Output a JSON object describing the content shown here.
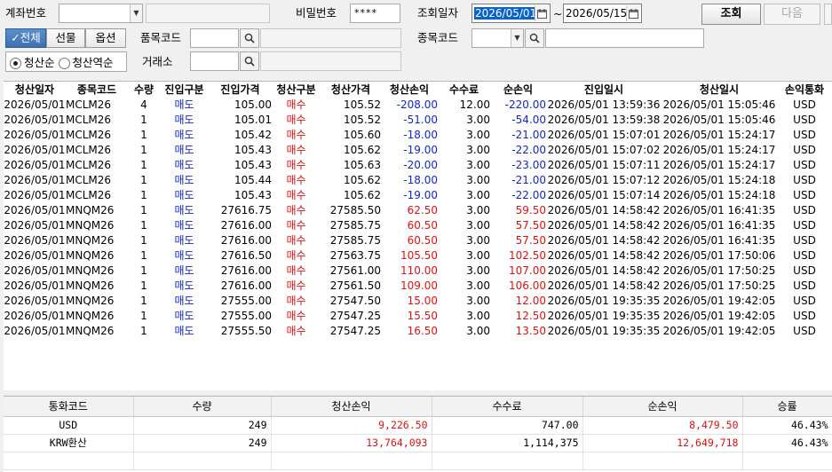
{
  "filters": {
    "account_label": "계좌번호",
    "password_label": "비밀번호",
    "password_value": "****",
    "query_date_label": "조회일자",
    "date_from": "2026/05/01",
    "date_tilde": "~",
    "date_to": "2026/05/15",
    "query_button": "조회",
    "next_button": "다음",
    "product_code_label": "품목코드",
    "item_code_label": "종목코드",
    "exchange_label": "거래소",
    "segments": [
      "전체",
      "선물",
      "옵션"
    ],
    "segment_check": "✓",
    "radio_liq_asc": "청산순",
    "radio_liq_desc": "청산역순"
  },
  "grid": {
    "headers": [
      "청산일자",
      "종목코드",
      "수량",
      "진입구분",
      "진입가격",
      "청산구분",
      "청산가격",
      "청산손익",
      "수수료",
      "순손익",
      "진입일시",
      "청산일시",
      "손익통화"
    ],
    "rows": [
      [
        "2026/05/01",
        "MCLM26",
        "4",
        "매도",
        "105.00",
        "매수",
        "105.52",
        "-208.00",
        "12.00",
        "-220.00",
        "2026/05/01  13:59:36",
        "2026/05/01  15:05:46",
        "USD"
      ],
      [
        "2026/05/01",
        "MCLM26",
        "1",
        "매도",
        "105.01",
        "매수",
        "105.52",
        "-51.00",
        "3.00",
        "-54.00",
        "2026/05/01  13:59:38",
        "2026/05/01  15:05:46",
        "USD"
      ],
      [
        "2026/05/01",
        "MCLM26",
        "1",
        "매도",
        "105.42",
        "매수",
        "105.60",
        "-18.00",
        "3.00",
        "-21.00",
        "2026/05/01  15:07:01",
        "2026/05/01  15:24:17",
        "USD"
      ],
      [
        "2026/05/01",
        "MCLM26",
        "1",
        "매도",
        "105.43",
        "매수",
        "105.62",
        "-19.00",
        "3.00",
        "-22.00",
        "2026/05/01  15:07:02",
        "2026/05/01  15:24:17",
        "USD"
      ],
      [
        "2026/05/01",
        "MCLM26",
        "1",
        "매도",
        "105.43",
        "매수",
        "105.63",
        "-20.00",
        "3.00",
        "-23.00",
        "2026/05/01  15:07:11",
        "2026/05/01  15:24:17",
        "USD"
      ],
      [
        "2026/05/01",
        "MCLM26",
        "1",
        "매도",
        "105.44",
        "매수",
        "105.62",
        "-18.00",
        "3.00",
        "-21.00",
        "2026/05/01  15:07:12",
        "2026/05/01  15:24:18",
        "USD"
      ],
      [
        "2026/05/01",
        "MCLM26",
        "1",
        "매도",
        "105.43",
        "매수",
        "105.62",
        "-19.00",
        "3.00",
        "-22.00",
        "2026/05/01  15:07:14",
        "2026/05/01  15:24:18",
        "USD"
      ],
      [
        "2026/05/01",
        "MNQM26",
        "1",
        "매도",
        "27616.75",
        "매수",
        "27585.50",
        "62.50",
        "3.00",
        "59.50",
        "2026/05/01  14:58:42",
        "2026/05/01  16:41:35",
        "USD"
      ],
      [
        "2026/05/01",
        "MNQM26",
        "1",
        "매도",
        "27616.00",
        "매수",
        "27585.75",
        "60.50",
        "3.00",
        "57.50",
        "2026/05/01  14:58:42",
        "2026/05/01  16:41:35",
        "USD"
      ],
      [
        "2026/05/01",
        "MNQM26",
        "1",
        "매도",
        "27616.00",
        "매수",
        "27585.75",
        "60.50",
        "3.00",
        "57.50",
        "2026/05/01  14:58:42",
        "2026/05/01  16:41:35",
        "USD"
      ],
      [
        "2026/05/01",
        "MNQM26",
        "1",
        "매도",
        "27616.50",
        "매수",
        "27563.75",
        "105.50",
        "3.00",
        "102.50",
        "2026/05/01  14:58:42",
        "2026/05/01  17:50:06",
        "USD"
      ],
      [
        "2026/05/01",
        "MNQM26",
        "1",
        "매도",
        "27616.00",
        "매수",
        "27561.00",
        "110.00",
        "3.00",
        "107.00",
        "2026/05/01  14:58:42",
        "2026/05/01  17:50:25",
        "USD"
      ],
      [
        "2026/05/01",
        "MNQM26",
        "1",
        "매도",
        "27616.00",
        "매수",
        "27561.50",
        "109.00",
        "3.00",
        "106.00",
        "2026/05/01  14:58:42",
        "2026/05/01  17:50:25",
        "USD"
      ],
      [
        "2026/05/01",
        "MNQM26",
        "1",
        "매도",
        "27555.00",
        "매수",
        "27547.50",
        "15.00",
        "3.00",
        "12.00",
        "2026/05/01  19:35:35",
        "2026/05/01  19:42:05",
        "USD"
      ],
      [
        "2026/05/01",
        "MNQM26",
        "1",
        "매도",
        "27555.00",
        "매수",
        "27547.25",
        "15.50",
        "3.00",
        "12.50",
        "2026/05/01  19:35:35",
        "2026/05/01  19:42:05",
        "USD"
      ],
      [
        "2026/05/01",
        "MNQM26",
        "1",
        "매도",
        "27555.50",
        "매수",
        "27547.25",
        "16.50",
        "3.00",
        "13.50",
        "2026/05/01  19:35:35",
        "2026/05/01  19:42:05",
        "USD"
      ]
    ]
  },
  "summary": {
    "headers": [
      "통화코드",
      "수량",
      "청산손익",
      "수수료",
      "순손익",
      "승률"
    ],
    "rows": [
      [
        "USD",
        "249",
        "9,226.50",
        "747.00",
        "8,479.50",
        "46.43%"
      ],
      [
        "KRW환산",
        "249",
        "13,764,093",
        "1,114,375",
        "12,649,718",
        "46.43%"
      ]
    ]
  },
  "colors": {
    "loss": "#1226c8",
    "profit": "#e01010",
    "sell": "#1226c8",
    "buy": "#e01010",
    "selected_date_bg": "#0a64c8",
    "segment_active": "#4a7bbd"
  }
}
